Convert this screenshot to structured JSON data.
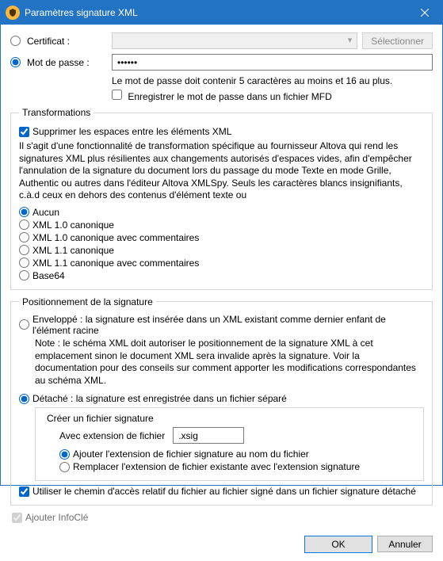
{
  "title": "Paramètres signature XML",
  "auth": {
    "cert_label": "Certificat :",
    "select_btn": "Sélectionner",
    "pass_label": "Mot de passe :",
    "pass_value": "••••••",
    "pass_hint": "Le mot de passe doit contenir 5 caractères au moins et 16 au plus.",
    "save_pass_label": "Enregistrer le mot de passe dans un fichier MFD"
  },
  "transforms": {
    "legend": "Transformations",
    "strip_ws_label": "Supprimer les espaces entre les éléments XML",
    "desc": "Il s'agit d'une fonctionnalité de transformation spécifique au fournisseur Altova qui rend les signatures XML plus résilientes aux changements autorisés d'espaces vides, afin d'empêcher l'annulation de la signature du document lors du passage du mode Texte en mode Grille, Authentic ou autres dans l'éditeur Altova XMLSpy. Seuls les caractères blancs insignifiants, c.à.d ceux en dehors des contenus d'élément texte ou",
    "options": [
      "Aucun",
      "XML 1.0 canonique",
      "XML 1.0 canonique avec commentaires",
      "XML 1.1 canonique",
      "XML 1.1 canonique avec commentaires",
      "Base64"
    ]
  },
  "placement": {
    "legend": "Positionnement de la signature",
    "enveloped_label": "Enveloppé : la signature est insérée dans un XML existant comme dernier enfant de l'élément racine",
    "enveloped_note": "Note : le schéma XML doit autoriser le positionnement de la signature XML à cet emplacement sinon le document XML sera invalide après la signature. Voir la documentation pour des conseils sur comment apporter les modifications correspondantes au schéma XML.",
    "detached_label": "Détaché : la signature est enregistrée dans un fichier séparé",
    "create_legend": "Créer un fichier signature",
    "ext_label": "Avec extension de fichier",
    "ext_value": ".xsig",
    "append_label": "Ajouter l'extension de fichier signature au nom du fichier",
    "replace_label": "Remplacer l'extension de fichier existante avec l'extension signature",
    "relative_path_label": "Utiliser le chemin d'accès relatif du fichier au fichier signé dans un fichier signature détaché"
  },
  "add_keyinfo_label": "Ajouter InfoClé",
  "buttons": {
    "ok": "OK",
    "cancel": "Annuler"
  }
}
